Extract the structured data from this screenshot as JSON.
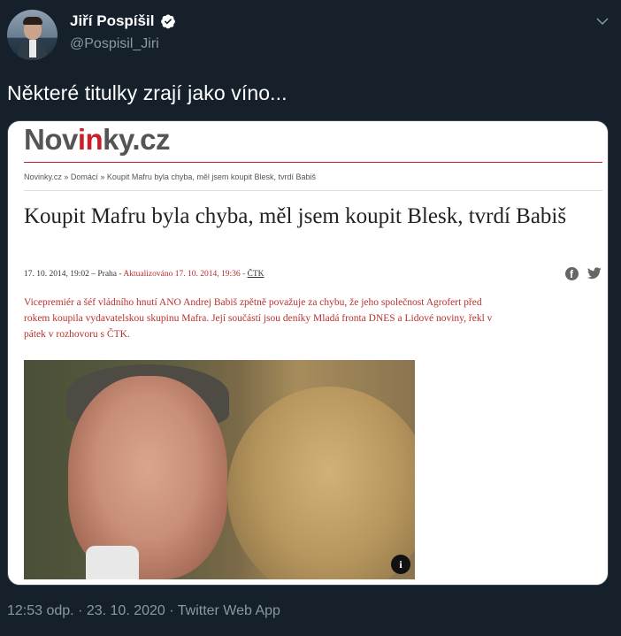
{
  "tweet": {
    "display_name": "Jiří Pospíšil",
    "handle": "@Pospisil_Jiri",
    "text": "Některé titulky zrají jako víno...",
    "timestamp": "12:53 odp. · 23. 10. 2020 · Twitter Web App",
    "verified": true,
    "colors": {
      "background": "#15202b",
      "secondary_text": "#8899a6",
      "verified_blue": "#1da1f2"
    }
  },
  "article": {
    "logo_prefix": "Nov",
    "logo_accent": "in",
    "logo_suffix": "ky.cz",
    "breadcrumb": "Novinky.cz » Domácí » Koupit Mafru byla chyba, měl jsem koupit Blesk, tvrdí Babiš",
    "title": "Koupit Mafru byla chyba, měl jsem koupit Blesk, tvrdí Babiš",
    "meta_date": "17. 10. 2014, 19:02 – Praha - ",
    "meta_updated": "Aktualizováno 17. 10. 2014, 19:36 - ",
    "meta_source": "ČTK",
    "perex": "Vicepremiér a šéf vládního hnutí ANO Andrej Babiš zpětně považuje za chybu, že jeho společnost Agrofert před rokem koupila vydavatelskou skupinu Mafra. Její součástí jsou deníky Mladá fronta DNES a Lidové noviny, řekl v pátek v rozhovoru s ČTK.",
    "photo_info": "i",
    "colors": {
      "brand_red": "#c8202a",
      "perex_red": "#b8322e"
    }
  },
  "icons": {
    "verified": "verified-badge-icon",
    "more": "chevron-down-icon",
    "facebook": "facebook-icon",
    "twitter": "twitter-icon",
    "info": "info-icon"
  }
}
